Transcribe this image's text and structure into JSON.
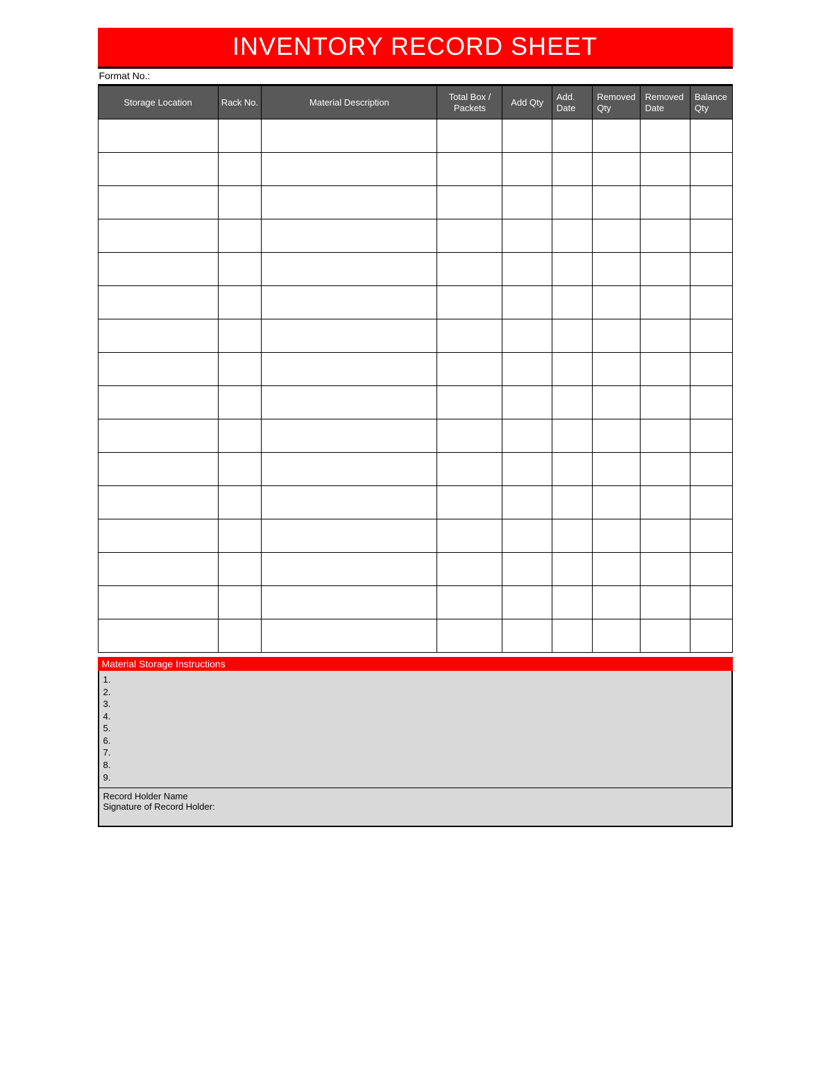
{
  "title": "INVENTORY RECORD SHEET",
  "format_no_label": "Format No.:",
  "columns": {
    "storage": "Storage Location",
    "rack": "Rack No.",
    "material": "Material Description",
    "totalbox": "Total Box / Packets",
    "addqty": "Add Qty",
    "adddate": "Add. Date",
    "remqty": "Removed Qty",
    "remdate": "Removed Date",
    "balqty": "Balance Qty"
  },
  "row_count": 16,
  "instructions_header": "Material Storage Instructions",
  "instructions": [
    "1.",
    "2.",
    "3.",
    "4.",
    "5.",
    "6.",
    "7.",
    "8.",
    "9."
  ],
  "record_holder_name_label": "Record Holder Name",
  "signature_label": "Signature of Record Holder:"
}
